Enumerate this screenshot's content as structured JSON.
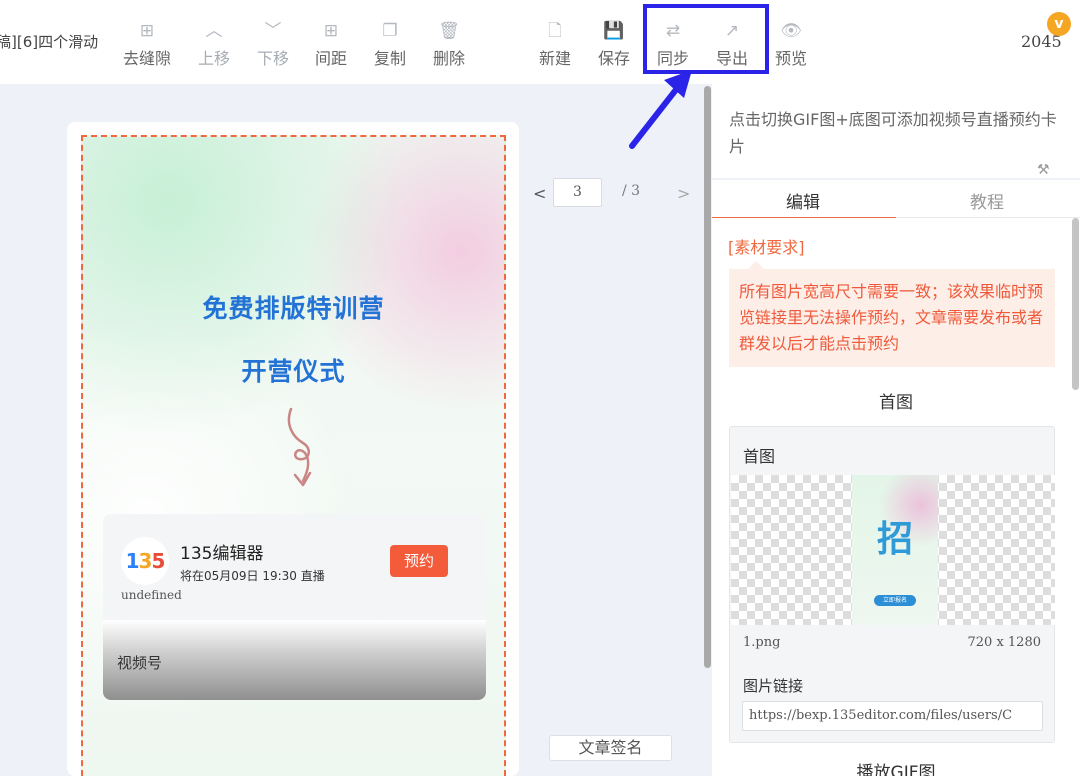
{
  "toolbar": {
    "doc_title": "稿][6]四个滑动",
    "buttons": [
      {
        "label": "去缝隙",
        "icon": "⊞"
      },
      {
        "label": "上移",
        "icon": "︿"
      },
      {
        "label": "下移",
        "icon": "﹀"
      },
      {
        "label": "间距",
        "icon": "⊞"
      },
      {
        "label": "复制",
        "icon": "❐"
      },
      {
        "label": "删除",
        "icon": "🗑"
      },
      {
        "label": "新建",
        "icon": "🗋"
      },
      {
        "label": "保存",
        "icon": "💾"
      },
      {
        "label": "同步",
        "icon": "⇄"
      },
      {
        "label": "导出",
        "icon": "↗"
      },
      {
        "label": "预览",
        "icon": "👁"
      }
    ],
    "counter": "2045",
    "badge": "v"
  },
  "preview": {
    "title_line1": "免费排版特训营",
    "title_line2": "开营仪式",
    "live_card": {
      "logo": {
        "p1": "1",
        "p2": "3",
        "p3": "5"
      },
      "account_name": "135编辑器",
      "live_time": "将在05月09日 19:30 直播",
      "reserve_label": "预约",
      "undefined_text": "undefined",
      "channel_label": "视频号"
    }
  },
  "pager": {
    "prev": "<",
    "current": "3",
    "total": "/ 3",
    "next": ">"
  },
  "sign_button": "文章签名",
  "right_panel": {
    "tip": "点击切换GIF图+底图可添加视频号直播预约卡片",
    "tabs": {
      "edit": "编辑",
      "tutorial": "教程"
    },
    "requirements_title": "[素材要求]",
    "requirements_text": "所有图片宽高尺寸需要一致；该效果临时预览链接里无法操作预约，文章需要发布或者群发以后才能点击预约",
    "section_cover": "首图",
    "cover_panel": {
      "label": "首图",
      "thumb_char": "招",
      "thumb_pill": "立即报名",
      "file_name": "1.png",
      "file_dims": "720 x 1280",
      "link_label": "图片链接",
      "link_value": "https://bexp.135editor.com/files/users/C"
    },
    "section_gif": "播放GIF图"
  },
  "colors": {
    "accent": "#f0683e",
    "highlight": "#2b23e8",
    "title_blue": "#2373d6",
    "reserve_red": "#f45b3a"
  }
}
